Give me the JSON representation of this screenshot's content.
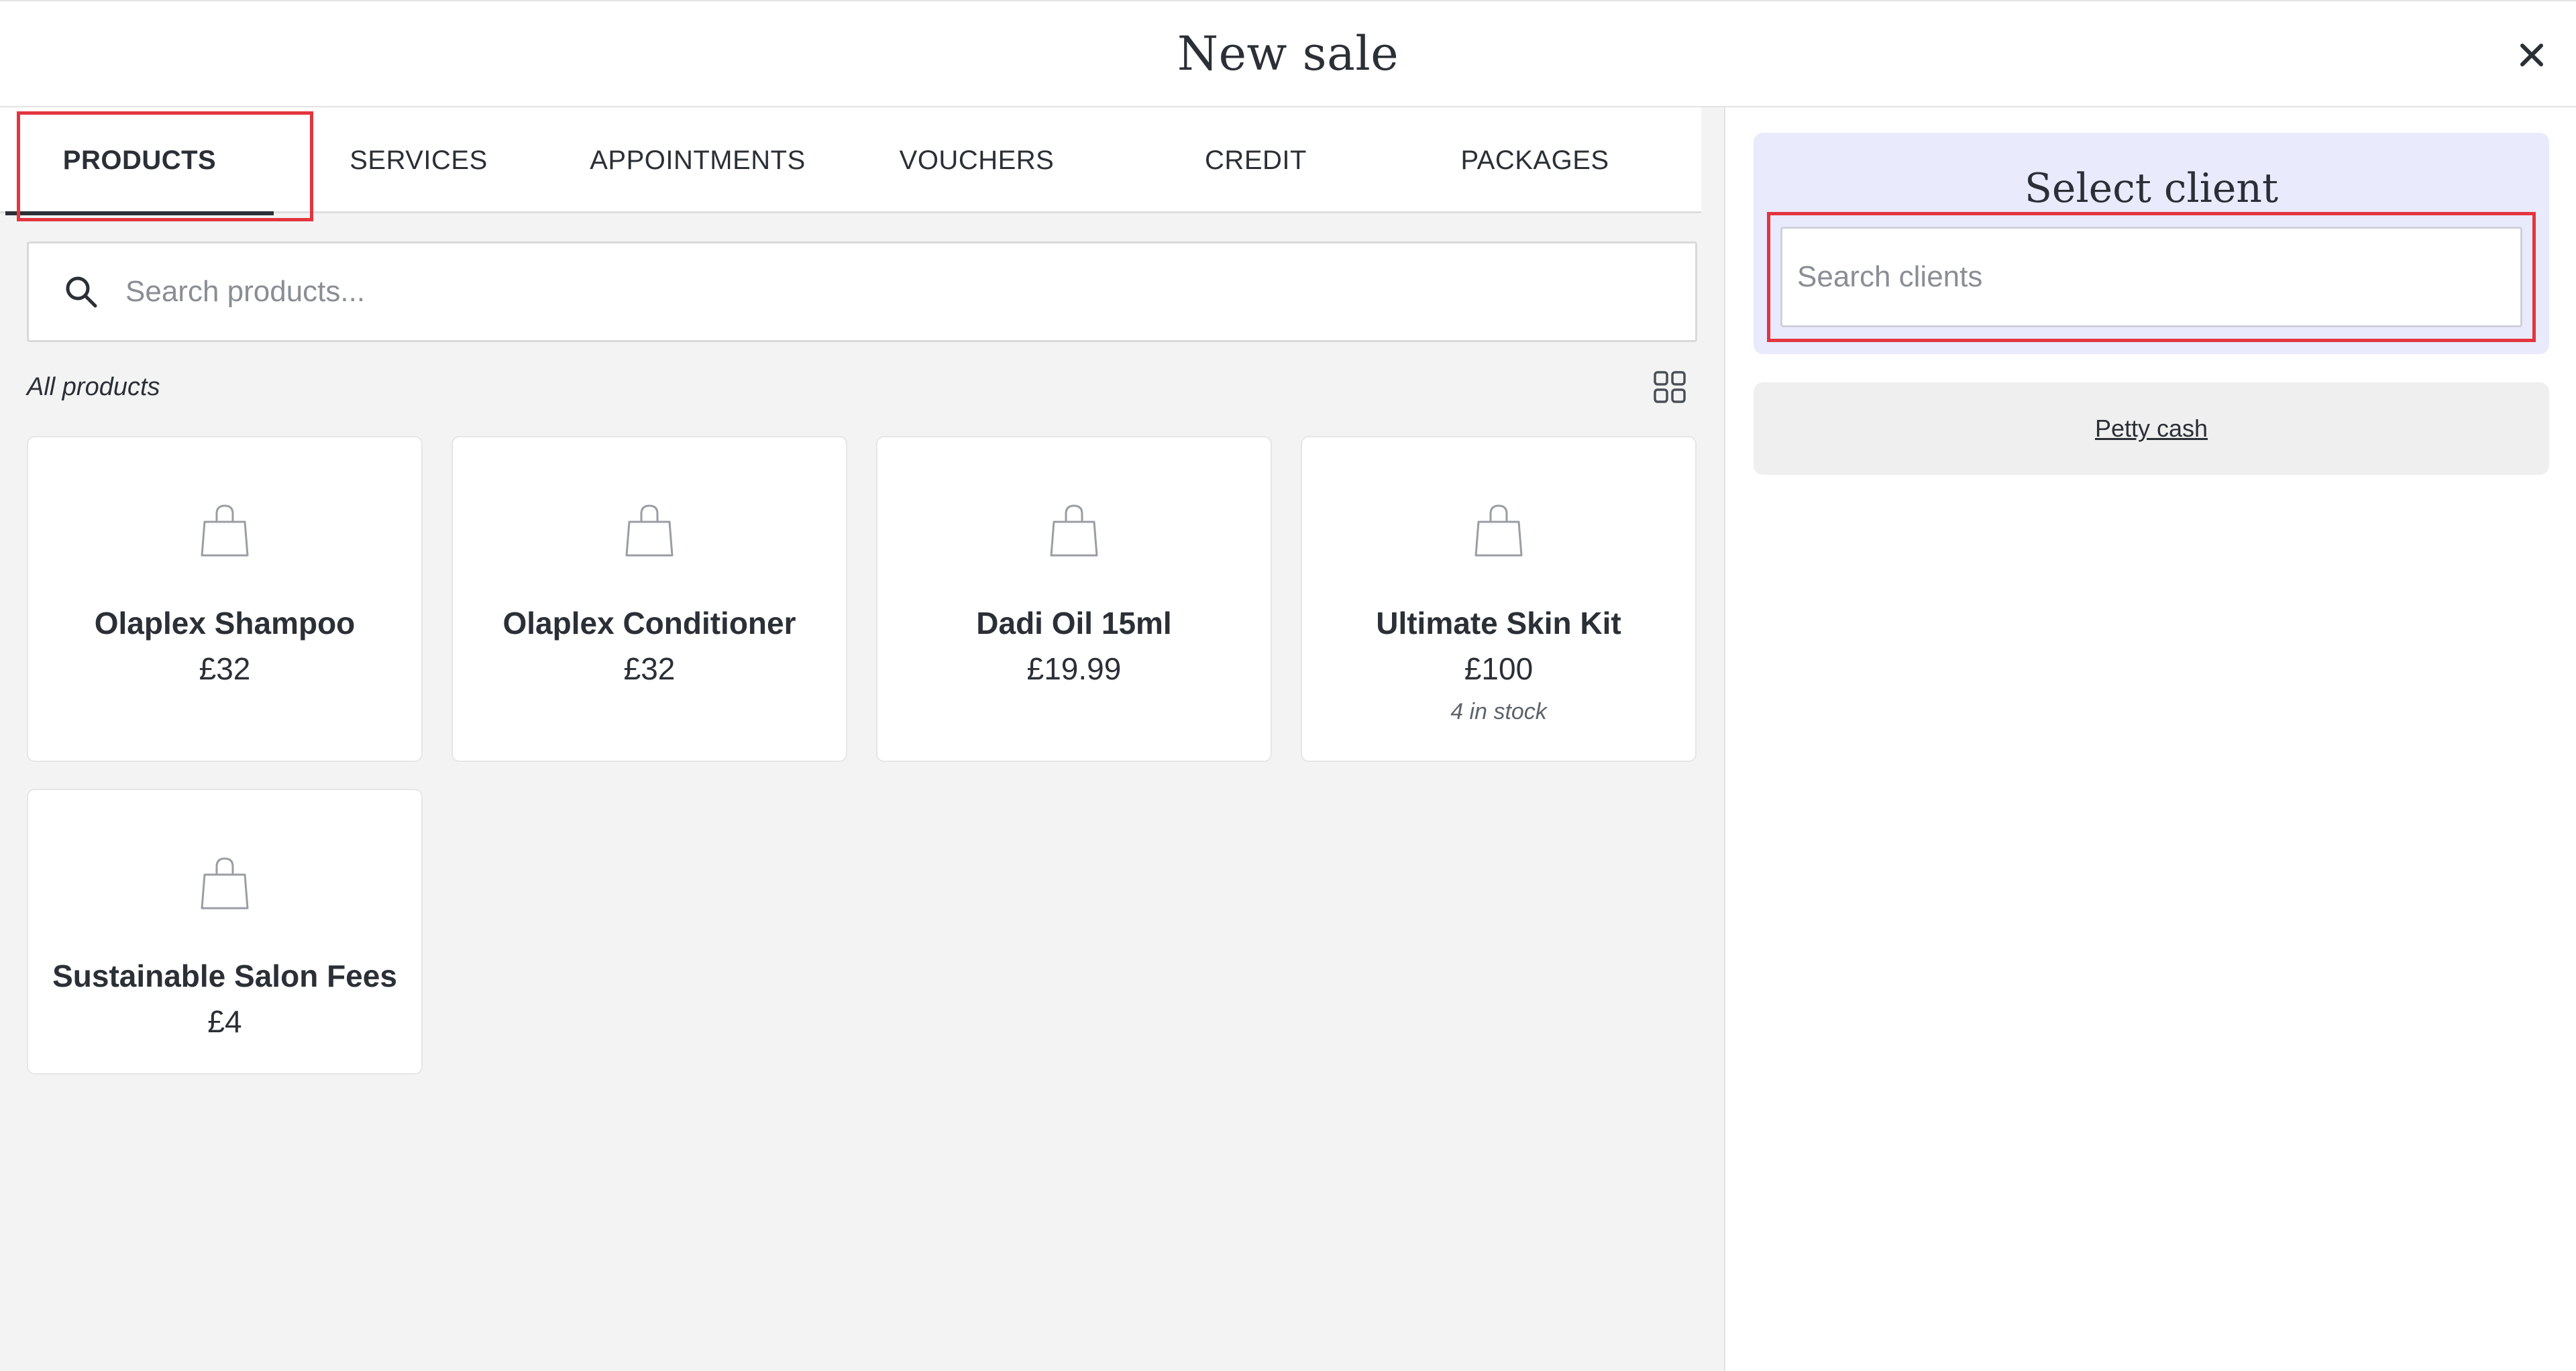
{
  "header": {
    "title": "New sale",
    "close_icon": "close-icon"
  },
  "tabs": [
    {
      "label": "PRODUCTS",
      "active": true
    },
    {
      "label": "SERVICES",
      "active": false
    },
    {
      "label": "APPOINTMENTS",
      "active": false
    },
    {
      "label": "VOUCHERS",
      "active": false
    },
    {
      "label": "CREDIT",
      "active": false
    },
    {
      "label": "PACKAGES",
      "active": false
    }
  ],
  "product_search": {
    "placeholder": "Search products...",
    "icon": "search-icon"
  },
  "products_section": {
    "label": "All products",
    "view_icon": "grid-view-icon"
  },
  "products": [
    {
      "name": "Olaplex Shampoo",
      "price": "£32",
      "stock": "",
      "icon": "shopping-bag-icon"
    },
    {
      "name": "Olaplex Conditioner",
      "price": "£32",
      "stock": "",
      "icon": "shopping-bag-icon"
    },
    {
      "name": "Dadi Oil 15ml",
      "price": "£19.99",
      "stock": "",
      "icon": "shopping-bag-icon"
    },
    {
      "name": "Ultimate Skin Kit",
      "price": "£100",
      "stock": "4 in stock",
      "icon": "shopping-bag-icon"
    },
    {
      "name": "Sustainable Salon Fees",
      "price": "£4",
      "stock": "",
      "icon": "shopping-bag-icon"
    }
  ],
  "client": {
    "title": "Select client",
    "search_placeholder": "Search clients",
    "petty_cash_label": "Petty cash"
  },
  "colors": {
    "highlight": "#e3353f",
    "client_panel_bg": "#e9eafc",
    "products_bg": "#f3f3f3",
    "text": "#2b2f36"
  }
}
